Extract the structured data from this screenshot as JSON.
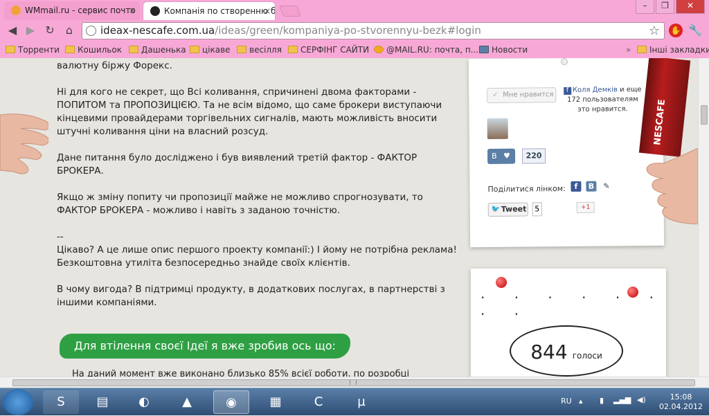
{
  "browser": {
    "tabs": [
      {
        "title": "WMmail.ru - сервис почто",
        "active": false
      },
      {
        "title": "Компанія по створенню бі",
        "active": true
      }
    ],
    "close_glyph": "×",
    "window_controls": [
      "–",
      "❐",
      "✕"
    ],
    "url_host": "ideax-nescafe.com.ua",
    "url_path": "/ideas/green/kompaniya-po-stvorennyu-bezk#login",
    "bookmarks": [
      "Торренти",
      "Кошильок",
      "Дашенька",
      "цікаве",
      "весілля",
      "СЕРФІНГ САЙТИ",
      "@MAIL.RU: почта, п...",
      "Новости"
    ],
    "other_bookmarks": "Інші закладки",
    "vk_badge": "B"
  },
  "article": {
    "paragraphs": [
      "валютну біржу Форекс.",
      "Ні для кого не секрет, що Всі коливання, спричинені двома факторами - ПОПИТОМ та ПРОПОЗИЦІЄЮ. Та не всім відомо, що саме брокери виступаючи кінцевими провайдерами торгівельних сигналів, мають можливість вносити штучні коливання ціни на власний розсуд.",
      "Дане питання було досліджено і був виявлений третій фактор - ФАКТОР БРОКЕРА.",
      "Якщо ж зміну попиту чи пропозиції майже не можливо спрогнозувати, то ФАКТОР БРОКЕРА - можливо і навіть з заданою точністю.",
      "--",
      "Цікаво? А це лише опис першого проекту компанії:) І йому не потрібна реклама! Безкоштовна утиліта безпосередньо знайде своїх клієнтів.",
      "В чому вигода? В підтримці продукту, в додаткових послугах, в партнерстві з іншими компаніями."
    ],
    "section_heading": "Для втілення своєї Ідеї я вже зробив ось що:",
    "cut_line": "На даний момент вже виконано близько 85% всієї роботи, по розробці"
  },
  "social": {
    "like_button": "Мне нравится",
    "fb_name": "Коля Демків",
    "fb_rest": "и еще 172 пользователям это нравится.",
    "fb_glyph": "f",
    "vk_letter": "B",
    "vk_heart": "♥",
    "vk_count": "220",
    "share_label": "Поділитися лінком:",
    "share_icons": [
      "f",
      "B",
      "✎"
    ],
    "tweet_label": "Tweet",
    "tweet_count": "5",
    "gplus_label": "+1"
  },
  "votes": {
    "count": "844",
    "label": "голоси"
  },
  "ad": {
    "brand": "NESCAFE"
  },
  "taskbar": {
    "lang": "RU",
    "time": "15:08",
    "date": "02.04.2012",
    "apps": [
      "skype-icon",
      "file-explorer-icon",
      "ccleaner-icon",
      "aimp-icon",
      "chrome-icon",
      "winrar-icon",
      "ccleaner-blue-icon",
      "utorrent-icon"
    ]
  },
  "colors": {
    "chrome_pink": "#f7a8d6",
    "pill_green": "#2ea043",
    "page_bg": "#e6e5e0",
    "taskbar_blue": "#2e4d73"
  }
}
